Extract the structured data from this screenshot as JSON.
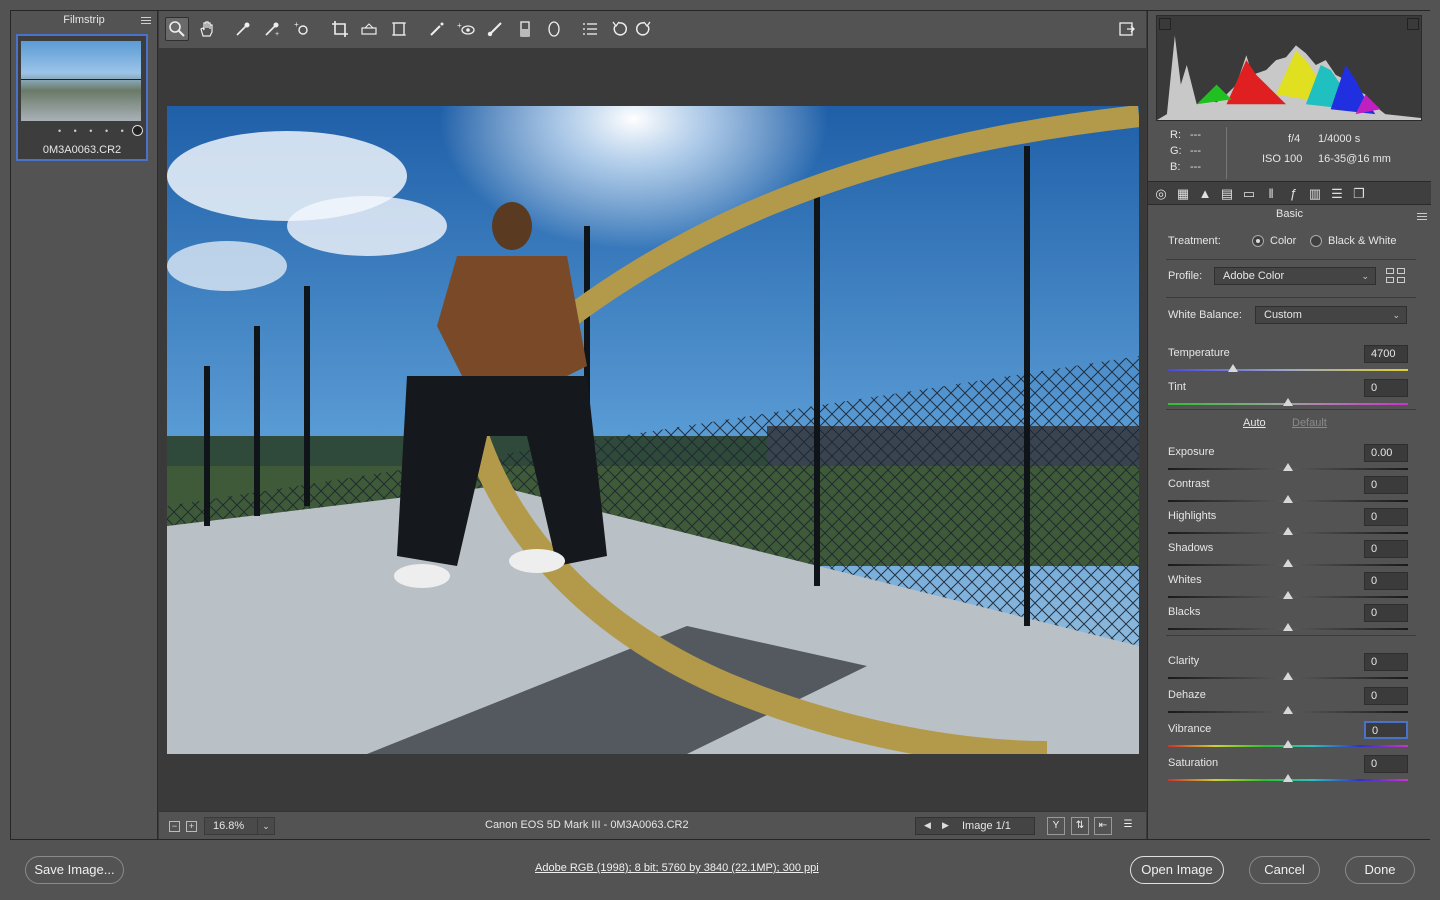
{
  "filmstrip": {
    "title": "Filmstrip",
    "thumbnail": {
      "name": "0M3A0063.CR2",
      "rating_dots": "• • • • •"
    }
  },
  "toolbar": {
    "tools": [
      "zoom-tool",
      "hand-tool",
      "white-balance-tool",
      "color-sampler-tool",
      "targeted-adjustment-tool",
      "crop-tool",
      "straighten-tool",
      "transform-tool",
      "spot-removal-tool",
      "red-eye-tool",
      "adjustment-brush-tool",
      "graduated-filter-tool",
      "radial-filter-tool",
      "preferences-tool",
      "rotate-left-tool",
      "rotate-right-tool"
    ],
    "active_tool": "zoom-tool"
  },
  "status": {
    "zoom": "16.8%",
    "minus": "−",
    "plus": "+",
    "caption": "Canon EOS 5D Mark III  -  0M3A0063.CR2",
    "image_counter": "Image 1/1",
    "prev": "◀",
    "next": "▶"
  },
  "histogram": {
    "rgb": {
      "r_label": "R:",
      "r": "---",
      "g_label": "G:",
      "g": "---",
      "b_label": "B:",
      "b": "---"
    },
    "aperture": "f/4",
    "shutter": "1/4000 s",
    "iso": "ISO 100",
    "lens": "16-35@16 mm"
  },
  "panel": {
    "title": "Basic",
    "treatment_label": "Treatment:",
    "treatment_options": [
      "Color",
      "Black & White"
    ],
    "treatment_selected": "Color",
    "profile_label": "Profile:",
    "profile_value": "Adobe Color",
    "wb_label": "White Balance:",
    "wb_value": "Custom",
    "auto": "Auto",
    "default": "Default",
    "sliders_wb": [
      {
        "name": "Temperature",
        "value": "4700",
        "pos": 0.27
      },
      {
        "name": "Tint",
        "value": "0",
        "pos": 0.5
      }
    ],
    "sliders_tone": [
      {
        "name": "Exposure",
        "value": "0.00",
        "pos": 0.5
      },
      {
        "name": "Contrast",
        "value": "0",
        "pos": 0.5
      },
      {
        "name": "Highlights",
        "value": "0",
        "pos": 0.5
      },
      {
        "name": "Shadows",
        "value": "0",
        "pos": 0.5
      },
      {
        "name": "Whites",
        "value": "0",
        "pos": 0.5
      },
      {
        "name": "Blacks",
        "value": "0",
        "pos": 0.5
      }
    ],
    "sliders_presence": [
      {
        "name": "Clarity",
        "value": "0",
        "pos": 0.5
      },
      {
        "name": "Dehaze",
        "value": "0",
        "pos": 0.5
      },
      {
        "name": "Vibrance",
        "value": "0",
        "pos": 0.5
      },
      {
        "name": "Saturation",
        "value": "0",
        "pos": 0.5
      }
    ]
  },
  "bottom": {
    "save": "Save Image...",
    "info": "Adobe RGB (1998); 8 bit; 5760 by 3840 (22.1MP); 300 ppi",
    "open": "Open Image",
    "cancel": "Cancel",
    "done": "Done"
  },
  "colors": {
    "accent": "#4b72c9",
    "panel": "#535353",
    "canvas": "#3a3a3a"
  }
}
